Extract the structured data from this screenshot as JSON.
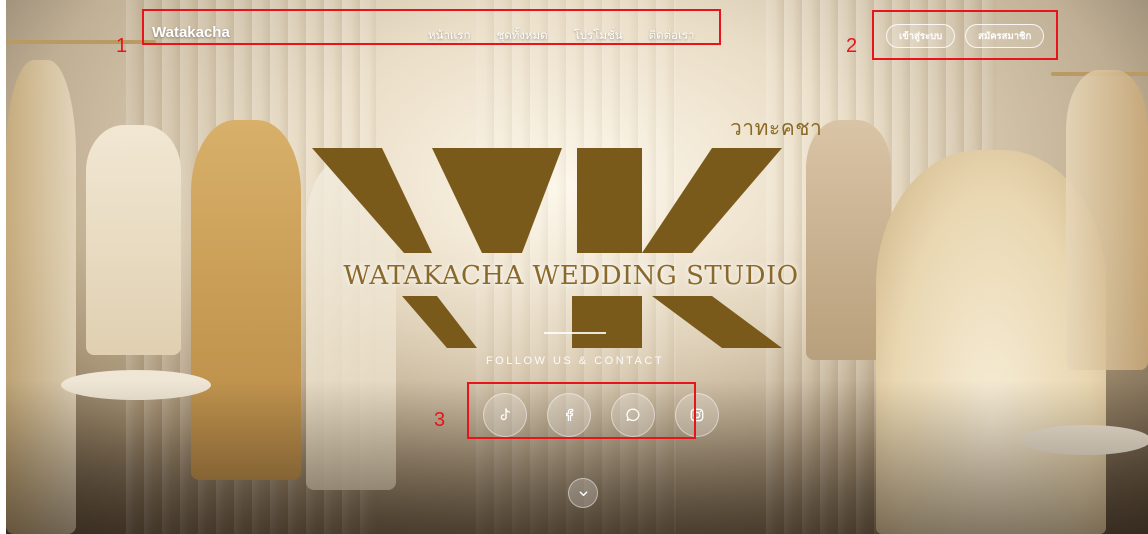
{
  "navbar": {
    "brand": "Watakacha",
    "links": [
      "หน้าแรก",
      "ชุดทั้งหมด",
      "โปรโมชั่น",
      "ติดต่อเรา"
    ],
    "login_label": "เข้าสู่ระบบ",
    "register_label": "สมัครสมาชิก"
  },
  "hero": {
    "logo_thai": "วาทะคชา",
    "logo_wordmark": "WATAKACHA WEDDING STUDIO",
    "follow_text": "FOLLOW US & CONTACT",
    "socials": [
      "tiktok-icon",
      "facebook-icon",
      "chat-icon",
      "instagram-icon"
    ],
    "scroll_icon": "chevron-down-icon"
  },
  "annotations": {
    "labels": [
      "1",
      "2",
      "3"
    ],
    "color": "#e8141c"
  },
  "colors": {
    "gold": "#8a6a24",
    "nav_text": "#ffffff"
  }
}
